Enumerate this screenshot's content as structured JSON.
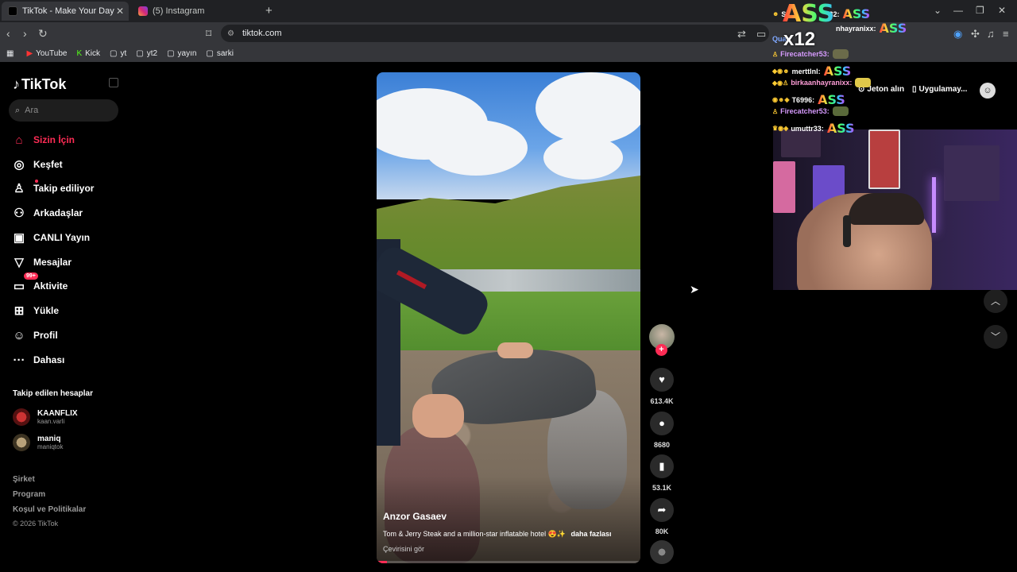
{
  "browser": {
    "tabs": [
      {
        "title": "TikTok - Make Your Day",
        "active": true
      },
      {
        "title": "(5) Instagram",
        "active": false
      }
    ],
    "url": "tiktok.com",
    "bookmarks": [
      "YouTube",
      "Kick",
      "yt",
      "yt2",
      "yayın",
      "sarki"
    ]
  },
  "tiktok": {
    "logo_text": "TikTok",
    "search_placeholder": "Ara",
    "nav": [
      {
        "label": "Sizin İçin",
        "icon": "home-icon",
        "active": true
      },
      {
        "label": "Keşfet",
        "icon": "compass-icon"
      },
      {
        "label": "Takip ediliyor",
        "icon": "following-icon"
      },
      {
        "label": "Arkadaşlar",
        "icon": "friends-icon"
      },
      {
        "label": "CANLI Yayın",
        "icon": "live-icon"
      },
      {
        "label": "Mesajlar",
        "icon": "messages-icon"
      },
      {
        "label": "Aktivite",
        "icon": "activity-icon",
        "badge": "99+"
      },
      {
        "label": "Yükle",
        "icon": "upload-icon"
      },
      {
        "label": "Profil",
        "icon": "profile-icon"
      },
      {
        "label": "Dahası",
        "icon": "more-icon"
      }
    ],
    "following_title": "Takip edilen hesaplar",
    "following": [
      {
        "name": "KAANFLIX",
        "handle": "kaan.varli"
      },
      {
        "name": "maniq",
        "handle": "maniqtok"
      }
    ],
    "footer": [
      "Şirket",
      "Program",
      "Koşul ve Politikalar"
    ],
    "copyright": "© 2026 TikTok"
  },
  "video": {
    "author": "Anzor Gasaev",
    "description": "Tom & Jerry Steak and a million-star inflatable hotel 😍✨",
    "more": "daha fazlası",
    "translate": "Çevirisini gör",
    "progress": 0.04,
    "likes": "613.4K",
    "comments": "8680",
    "saves": "53.1K",
    "shares": "80K"
  },
  "overlay": {
    "top_emote": "ASS",
    "multiplier": "x12",
    "jeton_label": "Jeton alın",
    "app_label": "Uygulamay...",
    "chat": [
      {
        "user": "S",
        "text": "32:",
        "emote": "ASS"
      },
      {
        "user": "",
        "text": "nhayranixx:",
        "emote": "ASS"
      },
      {
        "user": "Quar",
        "text": "",
        "emote": ""
      },
      {
        "user": "Firecatcher53:",
        "text": "",
        "emote": "small"
      },
      {
        "user": "merttlnl:",
        "text": "",
        "emote": "ASS"
      },
      {
        "user": "birkaanhayranixx:",
        "text": "",
        "emote": "small"
      },
      {
        "user": "T6996:",
        "text": "",
        "emote": "ASS"
      },
      {
        "user": "Firecatcher53:",
        "text": "",
        "emote": "small"
      },
      {
        "user": "umuttr33:",
        "text": "",
        "emote": "ASS"
      }
    ]
  },
  "colors": {
    "accent": "#fe2c55",
    "bg": "#000000"
  }
}
